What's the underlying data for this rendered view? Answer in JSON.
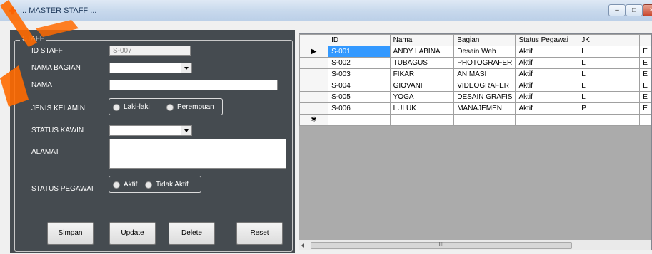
{
  "window": {
    "title": "... MASTER STAFF ...",
    "buttons": {
      "minimize": "–",
      "maximize": "□"
    }
  },
  "staff_form": {
    "group_title": "STAFF",
    "labels": {
      "id_staff": "ID STAFF",
      "nama_bagian": "NAMA BAGIAN",
      "nama": "NAMA",
      "jenis_kelamin": "JENIS KELAMIN",
      "status_kawin": "STATUS KAWIN",
      "alamat": "ALAMAT",
      "status_pegawai": "STATUS PEGAWAI"
    },
    "values": {
      "id_staff": "S-007",
      "nama_bagian": "",
      "nama": "",
      "status_kawin": "",
      "alamat": ""
    },
    "jenis_kelamin_options": [
      "Laki-laki",
      "Perempuan"
    ],
    "status_pegawai_options": [
      "Aktif",
      "Tidak Aktif"
    ],
    "buttons": {
      "simpan": "Simpan",
      "update": "Update",
      "delete": "Delete",
      "reset": "Reset"
    }
  },
  "grid": {
    "columns": [
      "ID",
      "Nama",
      "Bagian",
      "Status Pegawai",
      "JK"
    ],
    "rows": [
      [
        "S-001",
        "ANDY LABINA",
        "Desain Web",
        "Aktif",
        "L"
      ],
      [
        "S-002",
        "TUBAGUS",
        "PHOTOGRAFER",
        "Aktif",
        "L"
      ],
      [
        "S-003",
        "FIKAR",
        "ANIMASI",
        "Aktif",
        "L"
      ],
      [
        "S-004",
        "GIOVANI",
        "VIDEOGRAFER",
        "Aktif",
        "L"
      ],
      [
        "S-005",
        "YOGA",
        "DESAIN GRAFIS",
        "Aktif",
        "L"
      ],
      [
        "S-006",
        "LULUK",
        "MANAJEMEN",
        "Aktif",
        "P"
      ]
    ],
    "partial_col": "E",
    "current_row_marker": "▶",
    "new_row_marker": "✱",
    "scroll_grip": "III"
  },
  "colors": {
    "panel_bg": "#454b50",
    "selection": "#3399ff",
    "annotation": "#ff6a00"
  }
}
